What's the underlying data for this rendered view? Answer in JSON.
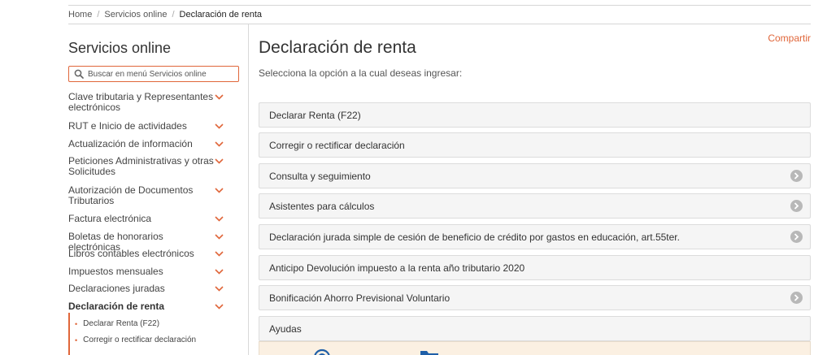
{
  "breadcrumb": {
    "items": [
      "Home",
      "Servicios online"
    ],
    "current": "Declaración de renta",
    "separator": "/"
  },
  "sidebar": {
    "title": "Servicios online",
    "search_placeholder": "Buscar en menú Servicios online",
    "items": [
      {
        "label": "Clave tributaria y Representantes electrónicos"
      },
      {
        "label": "RUT e Inicio de actividades"
      },
      {
        "label": "Actualización de información"
      },
      {
        "label": "Peticiones Administrativas y otras Solicitudes"
      },
      {
        "label": "Autorización de Documentos Tributarios"
      },
      {
        "label": "Factura electrónica"
      },
      {
        "label": "Boletas de honorarios electrónicas"
      },
      {
        "label": "Libros contables electrónicos"
      },
      {
        "label": "Impuestos mensuales"
      },
      {
        "label": "Declaraciones juradas"
      },
      {
        "label": "Declaración de renta"
      }
    ],
    "subitems": [
      {
        "label": "Declarar Renta (F22)"
      },
      {
        "label": "Corregir o rectificar declaración"
      }
    ]
  },
  "main": {
    "title": "Declaración de renta",
    "share_label": "Compartir",
    "subtitle": "Selecciona la opción a la cual deseas ingresar:",
    "options": [
      {
        "label": "Declarar Renta (F22)"
      },
      {
        "label": "Corregir o rectificar declaración"
      },
      {
        "label": "Consulta y seguimiento"
      },
      {
        "label": "Asistentes para cálculos"
      },
      {
        "label": "Declaración jurada simple de cesión de beneficio de crédito por gastos en educación, art.55ter."
      },
      {
        "label": "Anticipo Devolución impuesto a la renta año tributario 2020"
      },
      {
        "label": "Bonificación Ahorro Previsional Voluntario"
      },
      {
        "label": "Ayudas"
      }
    ]
  },
  "colors": {
    "accent": "#e0663a",
    "option_bg": "#f5f5f5",
    "help_panel_bg": "#fbf0e2",
    "arrow_icon": "#b8b8b8",
    "help_icon": "#1f5fa8"
  },
  "icons": {
    "search": "search-icon",
    "menu_expand": "chevron-down-icon",
    "option_go": "chevron-right-circle-icon",
    "help_circle": "help-circle-icon",
    "help_folder": "folder-icon"
  }
}
